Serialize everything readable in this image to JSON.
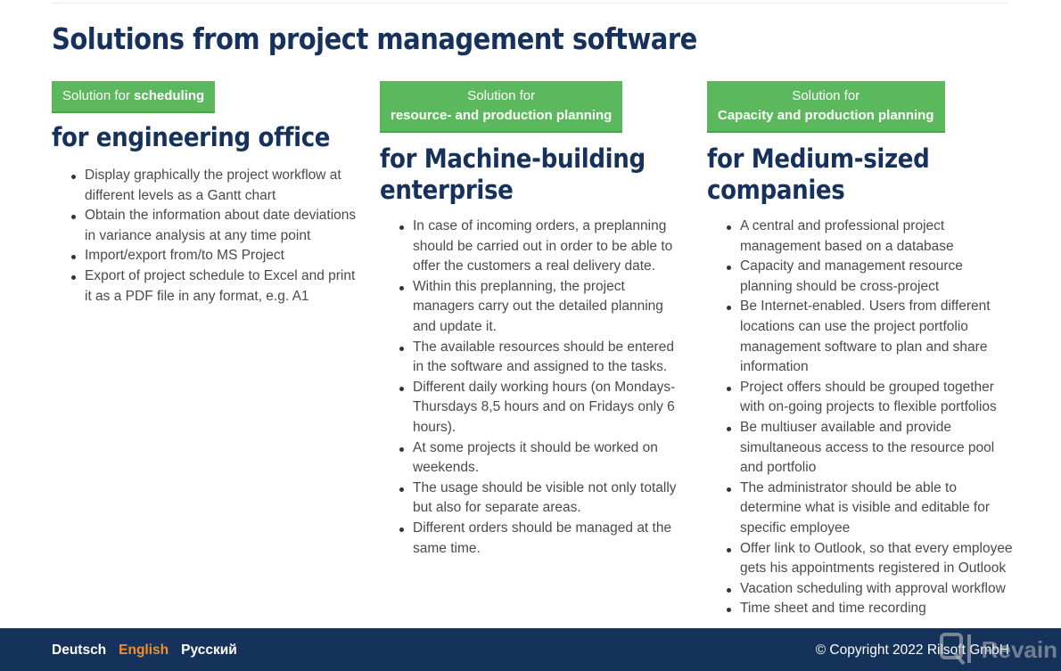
{
  "page": {
    "title": "Solutions from project management software"
  },
  "columns": [
    {
      "badge_prefix": "Solution for ",
      "badge_strong": "scheduling",
      "heading": "for engineering office",
      "items": [
        "Display graphically the project workflow at different levels as a Gantt chart",
        "Obtain the information about date deviations in variance analysis at any time point",
        "Import/export from/to MS Project",
        "Export of project schedule to Excel and print it as a PDF file in any format, e.g. A1"
      ]
    },
    {
      "badge_prefix": "Solution for",
      "badge_strong": "resource- and production planning",
      "heading": "for Machine-building enterprise",
      "items": [
        "In case of incoming orders, a preplanning should be carried out in order to be able to offer the customers a real delivery date.",
        "Within this preplanning, the project managers carry out the detailed planning and update it.",
        "The available resources should be entered in the software and assigned to the tasks.",
        "Different daily working hours (on Mondays-Thursdays 8,5 hours and on Fridays only 6 hours).",
        "At some projects it should be worked on weekends.",
        "The usage should be visible not only totally but also for separate areas.",
        "Different orders should be managed at the same time."
      ]
    },
    {
      "badge_prefix": "Solution for",
      "badge_strong": "Capacity and production planning",
      "heading": "for Medium-sized companies",
      "items": [
        "A central and professional project management based on a database",
        "Capacity and management resource planning should be cross-project",
        "Be Internet-enabled. Users from different locations can use the project portfolio management software to plan and share information",
        "Project offers should be grouped together with on-going projects to flexible portfolios",
        "Be multiuser available and provide simultaneous access to the resource pool and portfolio",
        "The administrator should be able to determine what is visible and editable for specific employee",
        "Offer link to Outlook, so that every employee gets his appointments registered in Outlook",
        "Vacation scheduling with approval workflow",
        "Time sheet and time recording"
      ]
    }
  ],
  "footer": {
    "languages": [
      {
        "label": "Deutsch",
        "active": false
      },
      {
        "label": "English",
        "active": true
      },
      {
        "label": "Русский",
        "active": false
      }
    ],
    "copyright": "© Copyright 2022 Rilsoft GmbH",
    "watermark": "Revain"
  },
  "colors": {
    "heading": "#16325c",
    "badge": "#5cb85c",
    "footer_bg": "#15335a",
    "active_language": "#f0902f"
  }
}
